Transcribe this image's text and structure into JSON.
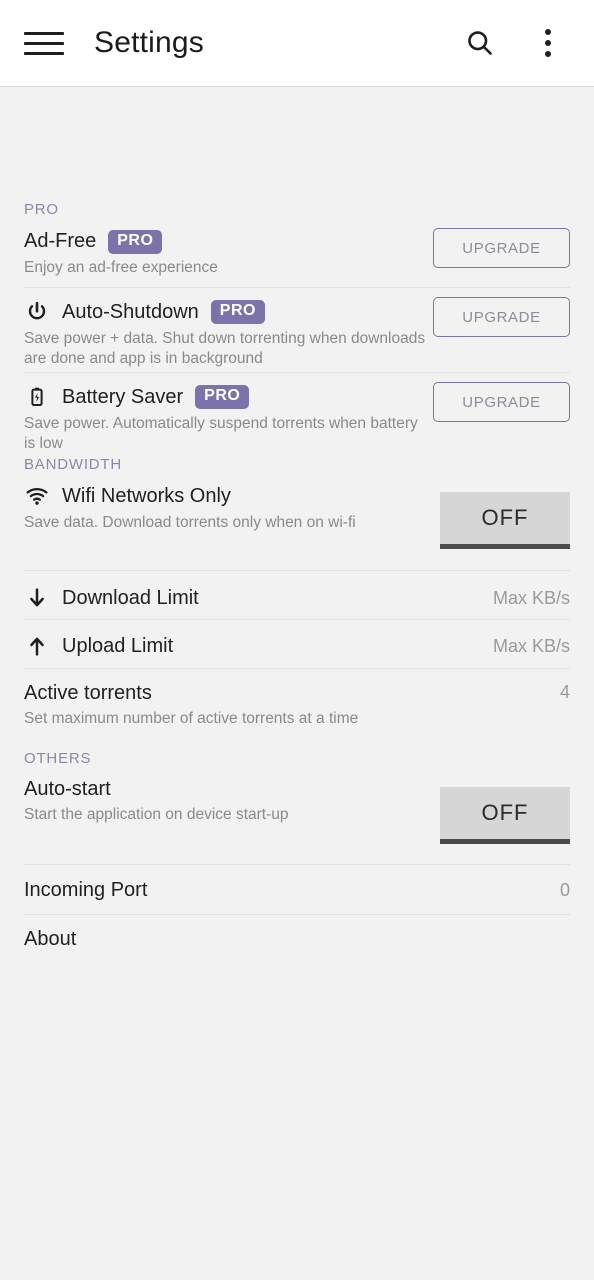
{
  "toolbar": {
    "menu_icon": "hamburger-menu-icon",
    "title": "Settings",
    "search_icon": "search-icon",
    "overflow_icon": "overflow-menu-icon"
  },
  "sections": [
    {
      "header": "PRO",
      "rows": [
        {
          "title": "Ad-Free",
          "badge": "PRO",
          "summary": "Enjoy an ad-free experience",
          "action": "UPGRADE",
          "icon": null
        },
        {
          "title": "Auto-Shutdown",
          "badge": "PRO",
          "summary": "Save power + data. Shut down torrenting when downloads are done and app is in background",
          "action": "UPGRADE",
          "icon": "power-icon"
        },
        {
          "title": "Battery Saver",
          "badge": "PRO",
          "summary": "Save power. Automatically suspend torrents when battery is low",
          "action": "UPGRADE",
          "icon": "battery-charging-icon"
        }
      ]
    },
    {
      "header": "BANDWIDTH",
      "rows": [
        {
          "title": "Wifi Networks Only",
          "summary": "Save data. Download torrents only when on wi-fi",
          "toggle": "OFF",
          "icon": "wifi-icon"
        },
        {
          "title": "Download Limit",
          "value": "Max KB/s",
          "icon": "arrow-down-icon"
        },
        {
          "title": "Upload Limit",
          "value": "Max KB/s",
          "icon": "arrow-up-icon"
        },
        {
          "title": "Active torrents",
          "summary": "Set maximum number of active torrents at a time",
          "value": "4",
          "icon": null
        }
      ]
    },
    {
      "header": "OTHERS",
      "rows": [
        {
          "title": "Auto-start",
          "summary": "Start the application on device start-up",
          "toggle": "OFF",
          "icon": null
        },
        {
          "title": "Incoming Port",
          "value": "0",
          "icon": null
        },
        {
          "title": "About",
          "icon": null
        }
      ]
    }
  ],
  "colors": {
    "accent_purple": "#7e72ab",
    "section_header": "#8b88a8",
    "page_background": "#f2f2f2",
    "toolbar_background": "#ffffff",
    "toggle_background": "#d6d6d6",
    "toggle_underline": "#4b4b4b"
  }
}
